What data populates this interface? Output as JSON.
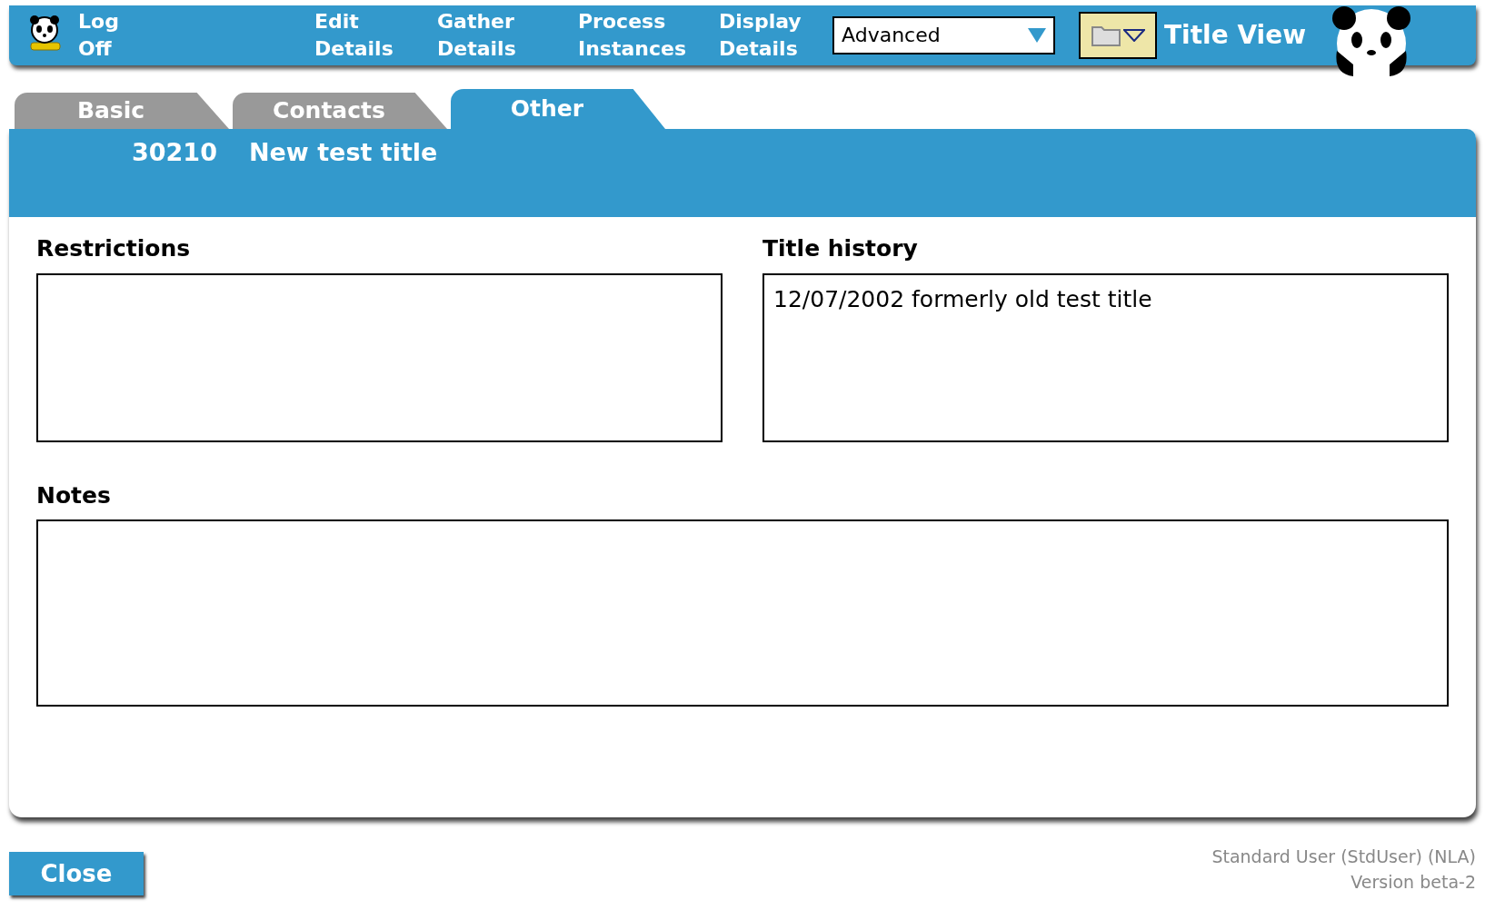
{
  "toolbar": {
    "logoff": "Log\nOff",
    "nav": [
      {
        "label": "Edit\nDetails"
      },
      {
        "label": "Gather\nDetails"
      },
      {
        "label": "Process\nInstances"
      },
      {
        "label": "Display\nDetails"
      }
    ],
    "mode_select": {
      "value": "Advanced"
    },
    "view_title": "Title View"
  },
  "tabs": [
    {
      "label": "Basic",
      "selected": false
    },
    {
      "label": "Contacts",
      "selected": false
    },
    {
      "label": "Other",
      "selected": true
    }
  ],
  "header": {
    "id": "30210",
    "title": "New test title"
  },
  "fields": [
    {
      "label": "Restrictions",
      "wide": false
    },
    {
      "label": "Title history",
      "value": "12/07/2002 formerly old test title",
      "wide": false
    },
    {
      "label": "Notes",
      "wide": true
    }
  ],
  "close_button": "Close",
  "footer": {
    "user": "Standard User (StdUser) (NLA)",
    "version": "Version beta-2"
  }
}
